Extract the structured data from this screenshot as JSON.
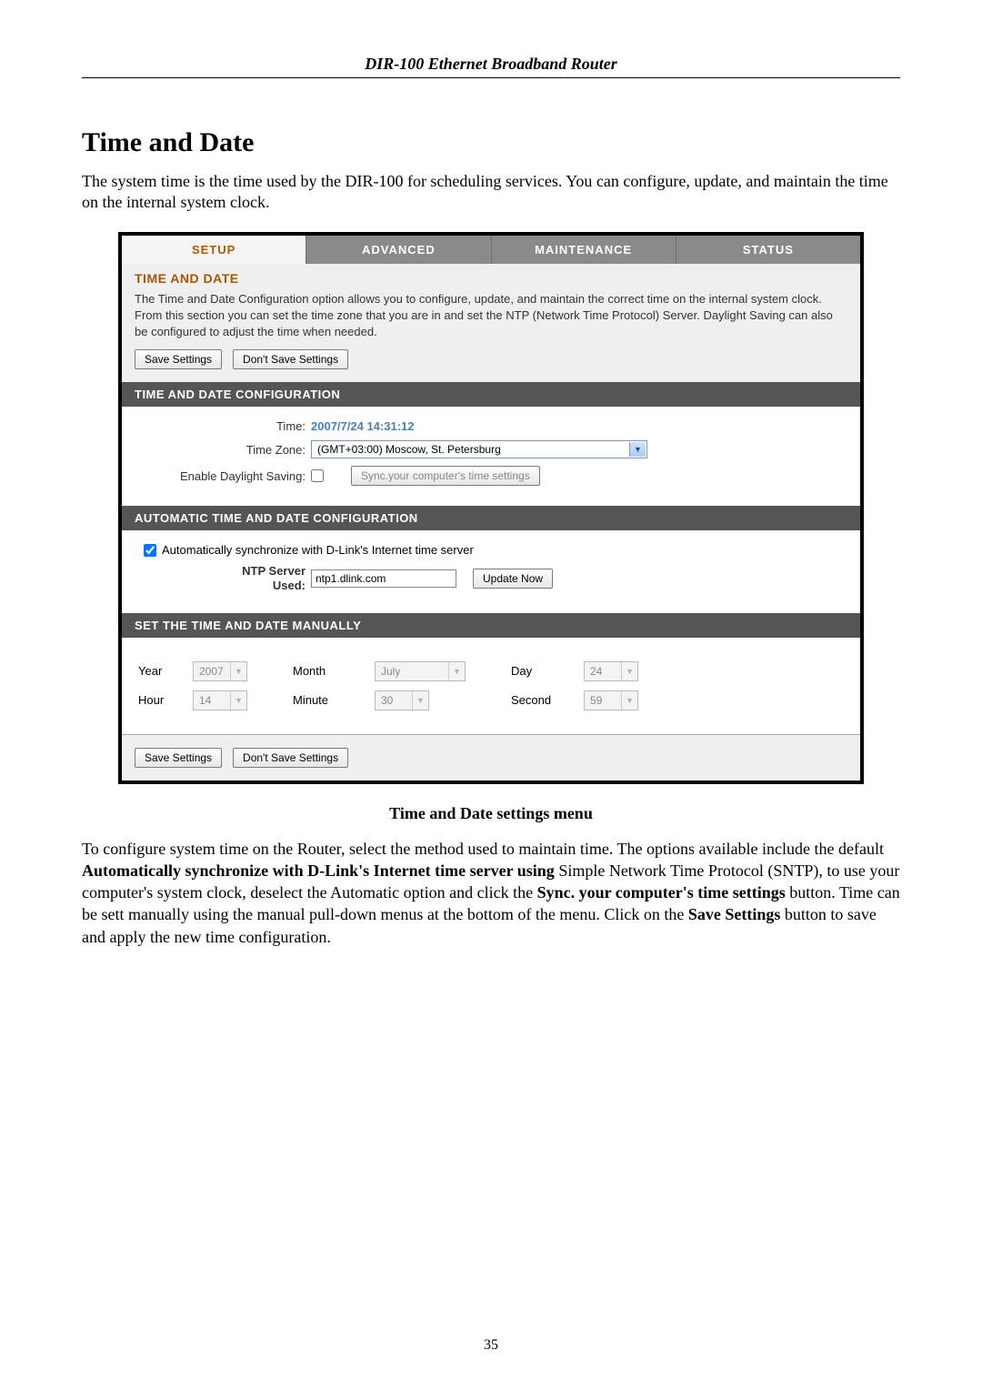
{
  "header": "DIR-100 Ethernet Broadband Router",
  "page_title": "Time and Date",
  "intro": "The system time is the time used by the DIR-100 for scheduling services. You can configure, update, and maintain the time on the internal system clock.",
  "tabs": {
    "setup": "SETUP",
    "advanced": "ADVANCED",
    "maintenance": "MAINTENANCE",
    "status": "STATUS"
  },
  "panel1": {
    "title": "TIME AND DATE",
    "text": "The Time and Date Configuration option allows you to configure, update, and maintain the correct time on the internal system clock. From this section you can set the time zone that you are in and set the NTP (Network Time Protocol) Server. Daylight Saving can also be configured to adjust the time when needed.",
    "save": "Save Settings",
    "dont": "Don't Save Settings"
  },
  "bar1": "TIME AND DATE CONFIGURATION",
  "cfg": {
    "time_label": "Time:",
    "time_value": "2007/7/24 14:31:12",
    "tz_label": "Time Zone:",
    "tz_value": "(GMT+03:00) Moscow, St. Petersburg",
    "ds_label": "Enable Daylight Saving:",
    "ds_checked": false,
    "sync_btn": "Sync.your computer's time settings"
  },
  "bar2": "AUTOMATIC TIME AND DATE CONFIGURATION",
  "auto": {
    "checked": true,
    "cb_label": "Automatically synchronize with D-Link's Internet time server",
    "ntp_label1": "NTP Server",
    "ntp_label2": "Used:",
    "ntp_value": "ntp1.dlink.com",
    "update_btn": "Update Now"
  },
  "bar3": "SET THE TIME AND DATE MANUALLY",
  "manual": {
    "year_l": "Year",
    "year_v": "2007",
    "month_l": "Month",
    "month_v": "July",
    "day_l": "Day",
    "day_v": "24",
    "hour_l": "Hour",
    "hour_v": "14",
    "minute_l": "Minute",
    "minute_v": "30",
    "second_l": "Second",
    "second_v": "59"
  },
  "bottom": {
    "save": "Save Settings",
    "dont": "Don't Save Settings"
  },
  "caption": "Time and Date settings menu",
  "after": {
    "p1a": "To configure system time on the Router, select the method used to maintain time. The options available include the default ",
    "p1b": "Automatically synchronize with D-Link's Internet time server using ",
    "p1c": "Simple Network Time Protocol (SNTP), to use your computer's system clock, deselect the Automatic option and click the ",
    "p1d": "Sync. your computer's time settings",
    "p1e": " button. Time can be sett manually using the manual pull-down menus at the bottom of the menu. Click on the ",
    "p1f": "Save Settings",
    "p1g": " button to save and apply the new time configuration."
  },
  "page_number": "35"
}
